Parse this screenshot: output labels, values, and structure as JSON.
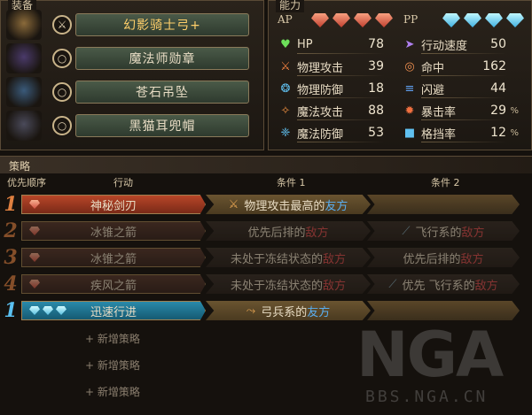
{
  "equipment": {
    "title": "装备",
    "items": [
      {
        "name": "幻影骑士弓+",
        "type_icon": "bow-icon",
        "image_icon": "bow-image-icon",
        "selected": true
      },
      {
        "name": "魔法师勋章",
        "type_icon": "ring-icon",
        "image_icon": "medal-image-icon",
        "selected": false
      },
      {
        "name": "苍石吊坠",
        "type_icon": "ring-icon",
        "image_icon": "pendant-image-icon",
        "selected": false
      },
      {
        "name": "黑猫耳兜帽",
        "type_icon": "ring-icon",
        "image_icon": "hood-image-icon",
        "selected": false
      }
    ]
  },
  "stats": {
    "title": "能力",
    "ap_label": "AP",
    "pp_label": "PP",
    "ap_gems": 4,
    "pp_gems": 4,
    "left": [
      {
        "label": "HP",
        "value": "78",
        "icon": "heart-icon",
        "color": "#6ee05a"
      },
      {
        "label": "物理攻击",
        "value": "39",
        "icon": "sword-icon",
        "color": "#f08040"
      },
      {
        "label": "物理防御",
        "value": "18",
        "icon": "armor-icon",
        "color": "#60c0f0"
      },
      {
        "label": "魔法攻击",
        "value": "88",
        "icon": "wand-icon",
        "color": "#f09040"
      },
      {
        "label": "魔法防御",
        "value": "53",
        "icon": "magic-shield-icon",
        "color": "#60c0f0"
      }
    ],
    "right": [
      {
        "label": "行动速度",
        "value": "50",
        "unit": "",
        "icon": "speed-icon",
        "color": "#b080f0"
      },
      {
        "label": "命中",
        "value": "162",
        "unit": "",
        "icon": "target-icon",
        "color": "#f09050"
      },
      {
        "label": "闪避",
        "value": "44",
        "unit": "",
        "icon": "evade-icon",
        "color": "#60a0f0"
      },
      {
        "label": "暴击率",
        "value": "29",
        "unit": "%",
        "icon": "crit-icon",
        "color": "#f07040"
      },
      {
        "label": "格挡率",
        "value": "12",
        "unit": "%",
        "icon": "block-icon",
        "color": "#60c0f0"
      }
    ]
  },
  "strategy": {
    "title": "策略",
    "headers": {
      "priority": "优先顺序",
      "action": "行动",
      "cond1": "条件 1",
      "cond2": "条件 2"
    },
    "rows": [
      {
        "num": "1",
        "gems": 1,
        "action": "神秘剑刃",
        "cond1_pre": "物理攻击最高的",
        "cond1_target": "友方",
        "cond1_target_type": "friend",
        "cond1_icon": "sword-icon",
        "cond2_pre": "",
        "cond2_target": "",
        "cond2_target_type": "",
        "cond2_icon": "",
        "active": true,
        "kind": "ap"
      },
      {
        "num": "2",
        "gems": 1,
        "action": "冰锥之箭",
        "cond1_pre": "优先后排的",
        "cond1_target": "敌方",
        "cond1_target_type": "enemy",
        "cond1_icon": "",
        "cond2_pre": "飞行系的",
        "cond2_target": "敌方",
        "cond2_target_type": "enemy",
        "cond2_icon": "wing-icon",
        "active": false,
        "kind": "ap"
      },
      {
        "num": "3",
        "gems": 1,
        "action": "冰锥之箭",
        "cond1_pre": "未处于冻结状态的",
        "cond1_target": "敌方",
        "cond1_target_type": "enemy",
        "cond1_icon": "",
        "cond2_pre": "优先后排的",
        "cond2_target": "敌方",
        "cond2_target_type": "enemy",
        "cond2_icon": "",
        "active": false,
        "kind": "ap"
      },
      {
        "num": "4",
        "gems": 1,
        "action": "疾风之箭",
        "cond1_pre": "未处于冻结状态的",
        "cond1_target": "敌方",
        "cond1_target_type": "enemy",
        "cond1_icon": "",
        "cond2_pre": "优先 飞行系的",
        "cond2_target": "敌方",
        "cond2_target_type": "enemy",
        "cond2_icon": "wing-icon",
        "active": false,
        "kind": "ap"
      },
      {
        "num": "1",
        "gems": 3,
        "action": "迅速行进",
        "cond1_pre": "弓兵系的",
        "cond1_target": "友方",
        "cond1_target_type": "friend",
        "cond1_icon": "bow-icon",
        "cond2_pre": "",
        "cond2_target": "",
        "cond2_target_type": "",
        "cond2_icon": "",
        "active": true,
        "kind": "pp"
      }
    ],
    "add_label": "+ 新增策略",
    "add_count": 3
  },
  "watermark": {
    "logo": "NGA",
    "url": "BBS.NGA.CN"
  }
}
